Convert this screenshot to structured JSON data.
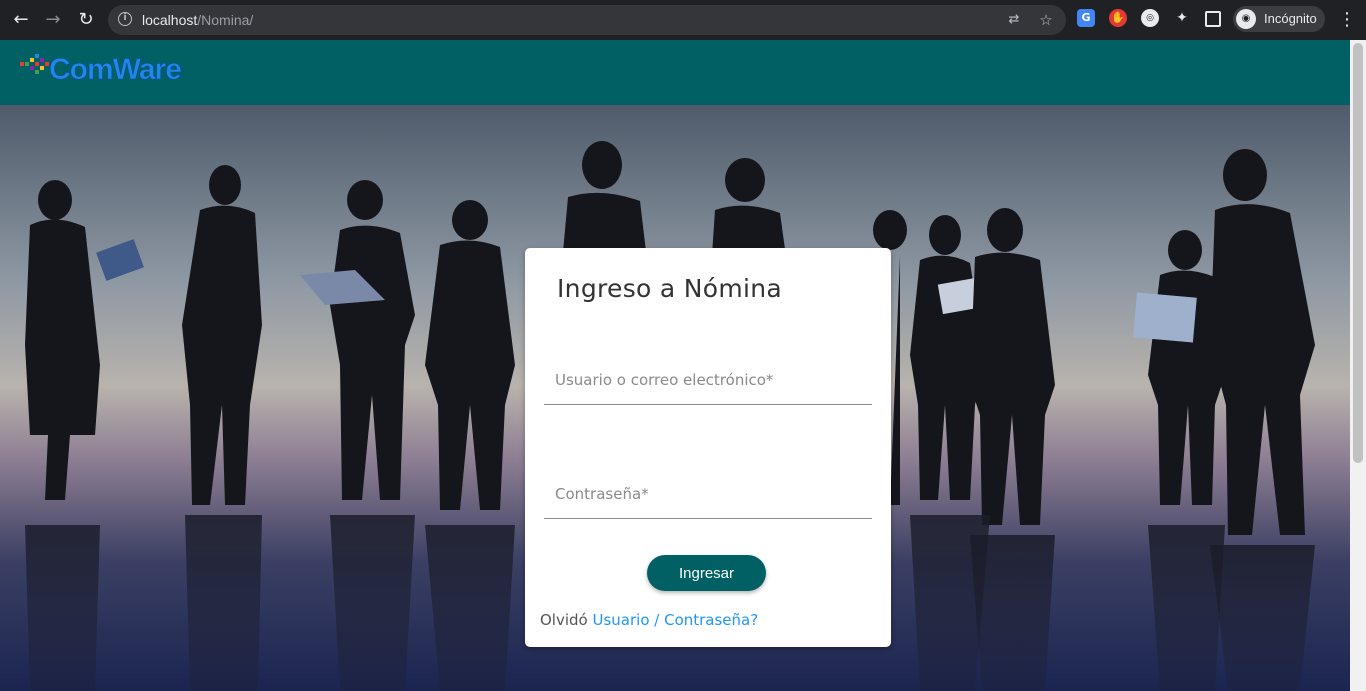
{
  "browser": {
    "url_host": "localhost",
    "url_path": "/Nomina/",
    "profile_label": "Incógnito",
    "icons": [
      "back-arrow-icon",
      "forward-arrow-icon",
      "reload-icon",
      "info-icon",
      "translate-icon",
      "star-icon",
      "google-translate-extension-icon",
      "adblock-extension-icon",
      "extension-icon",
      "puzzle-icon",
      "side-panel-icon",
      "incognito-icon",
      "more-menu-icon"
    ]
  },
  "header": {
    "logo_text": "ComWare",
    "background_color": "#006064"
  },
  "login": {
    "title": "Ingreso a Nómina",
    "username_placeholder": "Usuario o correo electrónico*",
    "password_placeholder": "Contraseña*",
    "submit_label": "Ingresar",
    "forgot_prefix": "Olvidó",
    "forgot_link": "Usuario / Contraseña?",
    "accent_color": "#006064",
    "link_color": "#2196f3"
  }
}
